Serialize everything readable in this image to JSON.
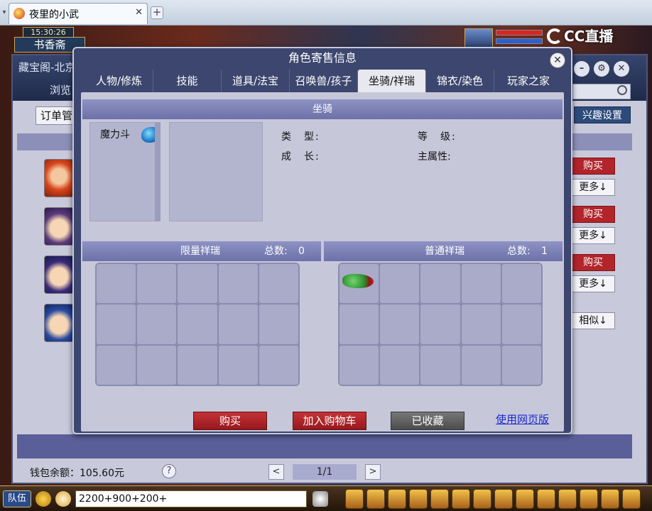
{
  "browser": {
    "tab_title": "夜里的小武",
    "tab_close": "✕",
    "new_tab": "+"
  },
  "hud": {
    "time": "15:30:26",
    "location": "书香斋",
    "cc_logo": "CC直播"
  },
  "back_window": {
    "title": "藏宝阁-北京",
    "browse": "浏览",
    "order_button": "订单管",
    "interest_button": "兴趣设置",
    "side_buttons": [
      {
        "label": "购买",
        "kind": "buy"
      },
      {
        "label": "更多↓",
        "kind": "more"
      },
      {
        "label": "购买",
        "kind": "buy"
      },
      {
        "label": "更多↓",
        "kind": "more"
      },
      {
        "label": "购买",
        "kind": "buy"
      },
      {
        "label": "更多↓",
        "kind": "more"
      },
      {
        "label": "相似↓",
        "kind": "more"
      }
    ],
    "wallet": "钱包余额：105.60元",
    "help": "?",
    "page": "1/1",
    "prev": "<",
    "next": ">"
  },
  "dialog": {
    "title": "角色寄售信息",
    "close": "✕",
    "tabs": [
      "人物/修炼",
      "技能",
      "道具/法宝",
      "召唤兽/孩子",
      "坐骑/祥瑞",
      "锦衣/染色",
      "玩家之家"
    ],
    "active_tab": "坐骑/祥瑞",
    "mount_section": "坐骑",
    "mount_item": "魔力斗",
    "labels": {
      "type": "类　型:",
      "growth": "成　长:",
      "level": "等　级:",
      "main_attr": "主属性:"
    },
    "limited": {
      "title": "限量祥瑞",
      "total_label": "总数:",
      "total": "0"
    },
    "normal": {
      "title": "普通祥瑞",
      "total_label": "总数:",
      "total": "1"
    },
    "buttons": {
      "buy": "购买",
      "add_cart": "加入购物车",
      "favorited": "已收藏",
      "web": "使用网页版"
    }
  },
  "toolbar": {
    "team": "队伍",
    "chat_text": "2200+900+200+"
  }
}
